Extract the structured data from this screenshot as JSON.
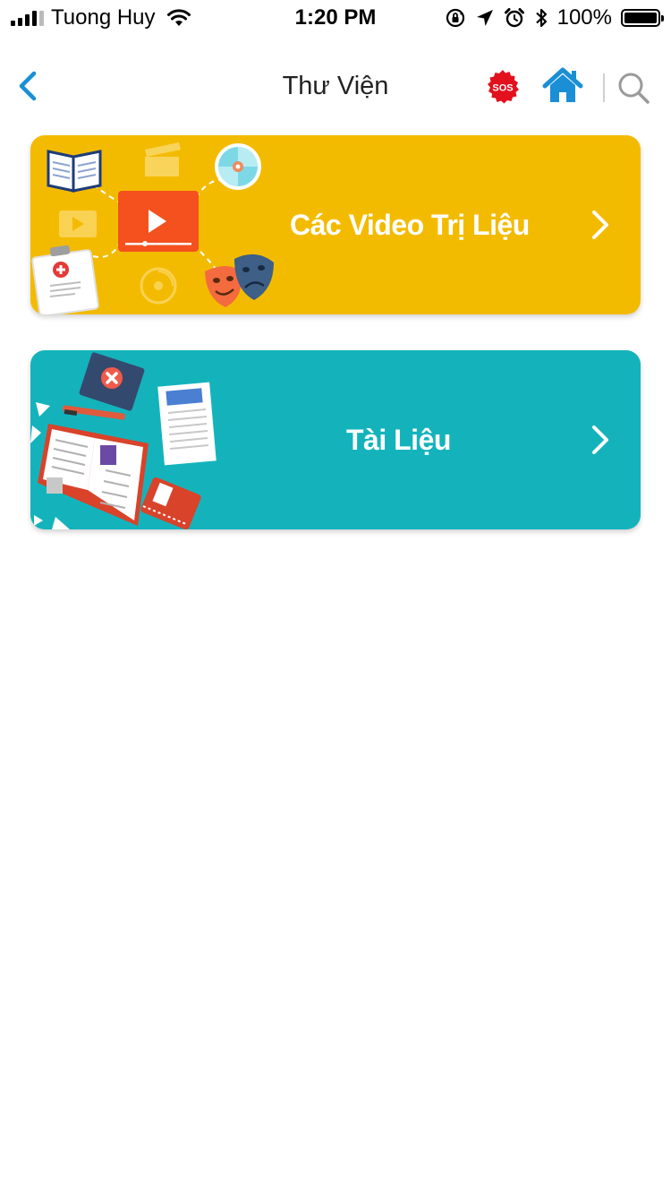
{
  "status_bar": {
    "carrier": "Tuong Huy",
    "time": "1:20 PM",
    "battery": "100%"
  },
  "nav": {
    "title": "Thư Viện",
    "sos_label": "SOS",
    "accent_color": "#1a8fd6"
  },
  "cards": [
    {
      "label": "Các Video Trị Liệu",
      "color": "#f3bb00"
    },
    {
      "label": "Tài Liệu",
      "color": "#14b3bc"
    }
  ]
}
